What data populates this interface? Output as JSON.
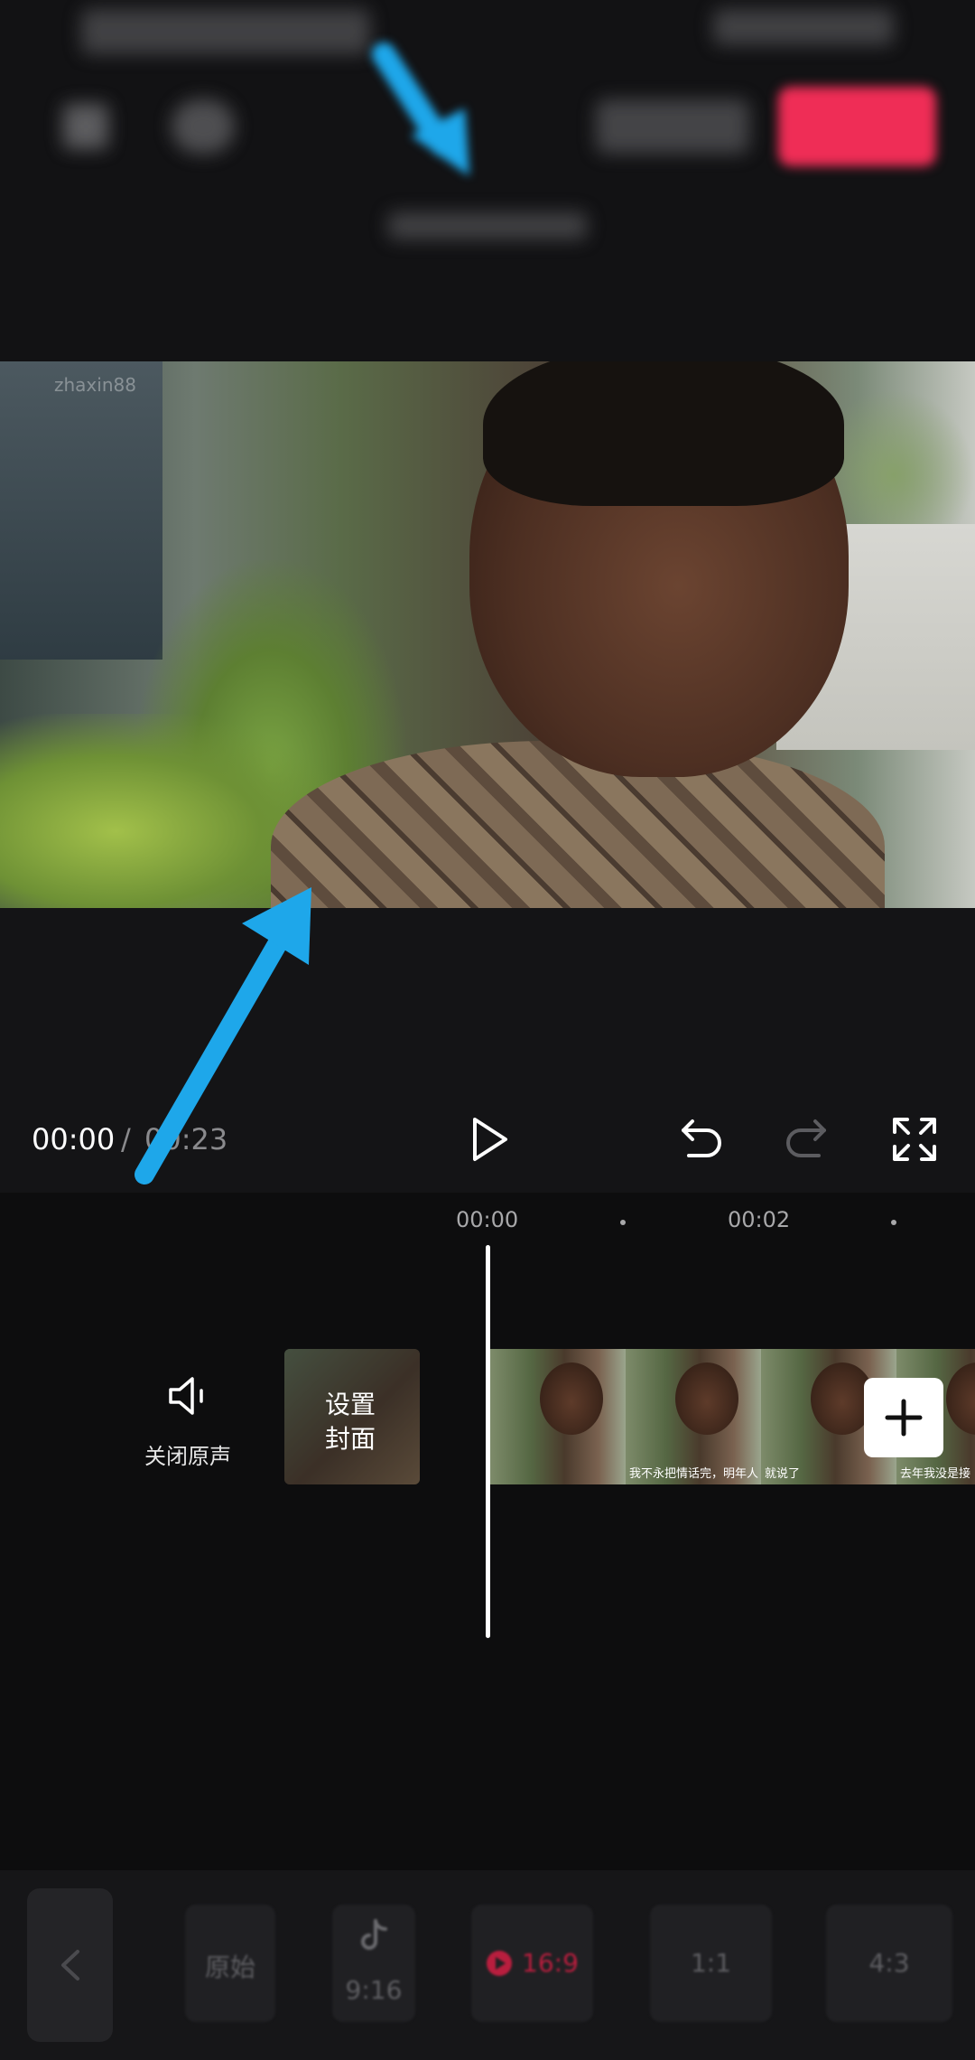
{
  "top_bar": {
    "export_color": "#ef2d56"
  },
  "preview": {
    "watermark": "zhaxin88"
  },
  "player": {
    "time_current": "00:00",
    "time_separator": "/",
    "time_total": "00:23",
    "icons": {
      "play": "play-icon",
      "undo": "undo-icon",
      "redo": "redo-icon",
      "fullscreen": "fullscreen-icon"
    }
  },
  "timeline": {
    "ruler": [
      "00:00",
      "00:02"
    ],
    "mute_label": "关闭原声",
    "cover_label_line1": "设置",
    "cover_label_line2": "封面",
    "frames": [
      {
        "subtitle": ""
      },
      {
        "subtitle": "我不永把情话完，明年人"
      },
      {
        "subtitle": "就说了"
      },
      {
        "subtitle": "去年我没是接"
      }
    ]
  },
  "ratio_bar": {
    "items": [
      {
        "label": "原始"
      },
      {
        "label": "9:16"
      },
      {
        "label": "16:9"
      },
      {
        "label": "1:1"
      },
      {
        "label": "4:3"
      }
    ],
    "selected": "16:9",
    "accent": "#b81e3e"
  },
  "annotation_color": "#1ea7ea"
}
